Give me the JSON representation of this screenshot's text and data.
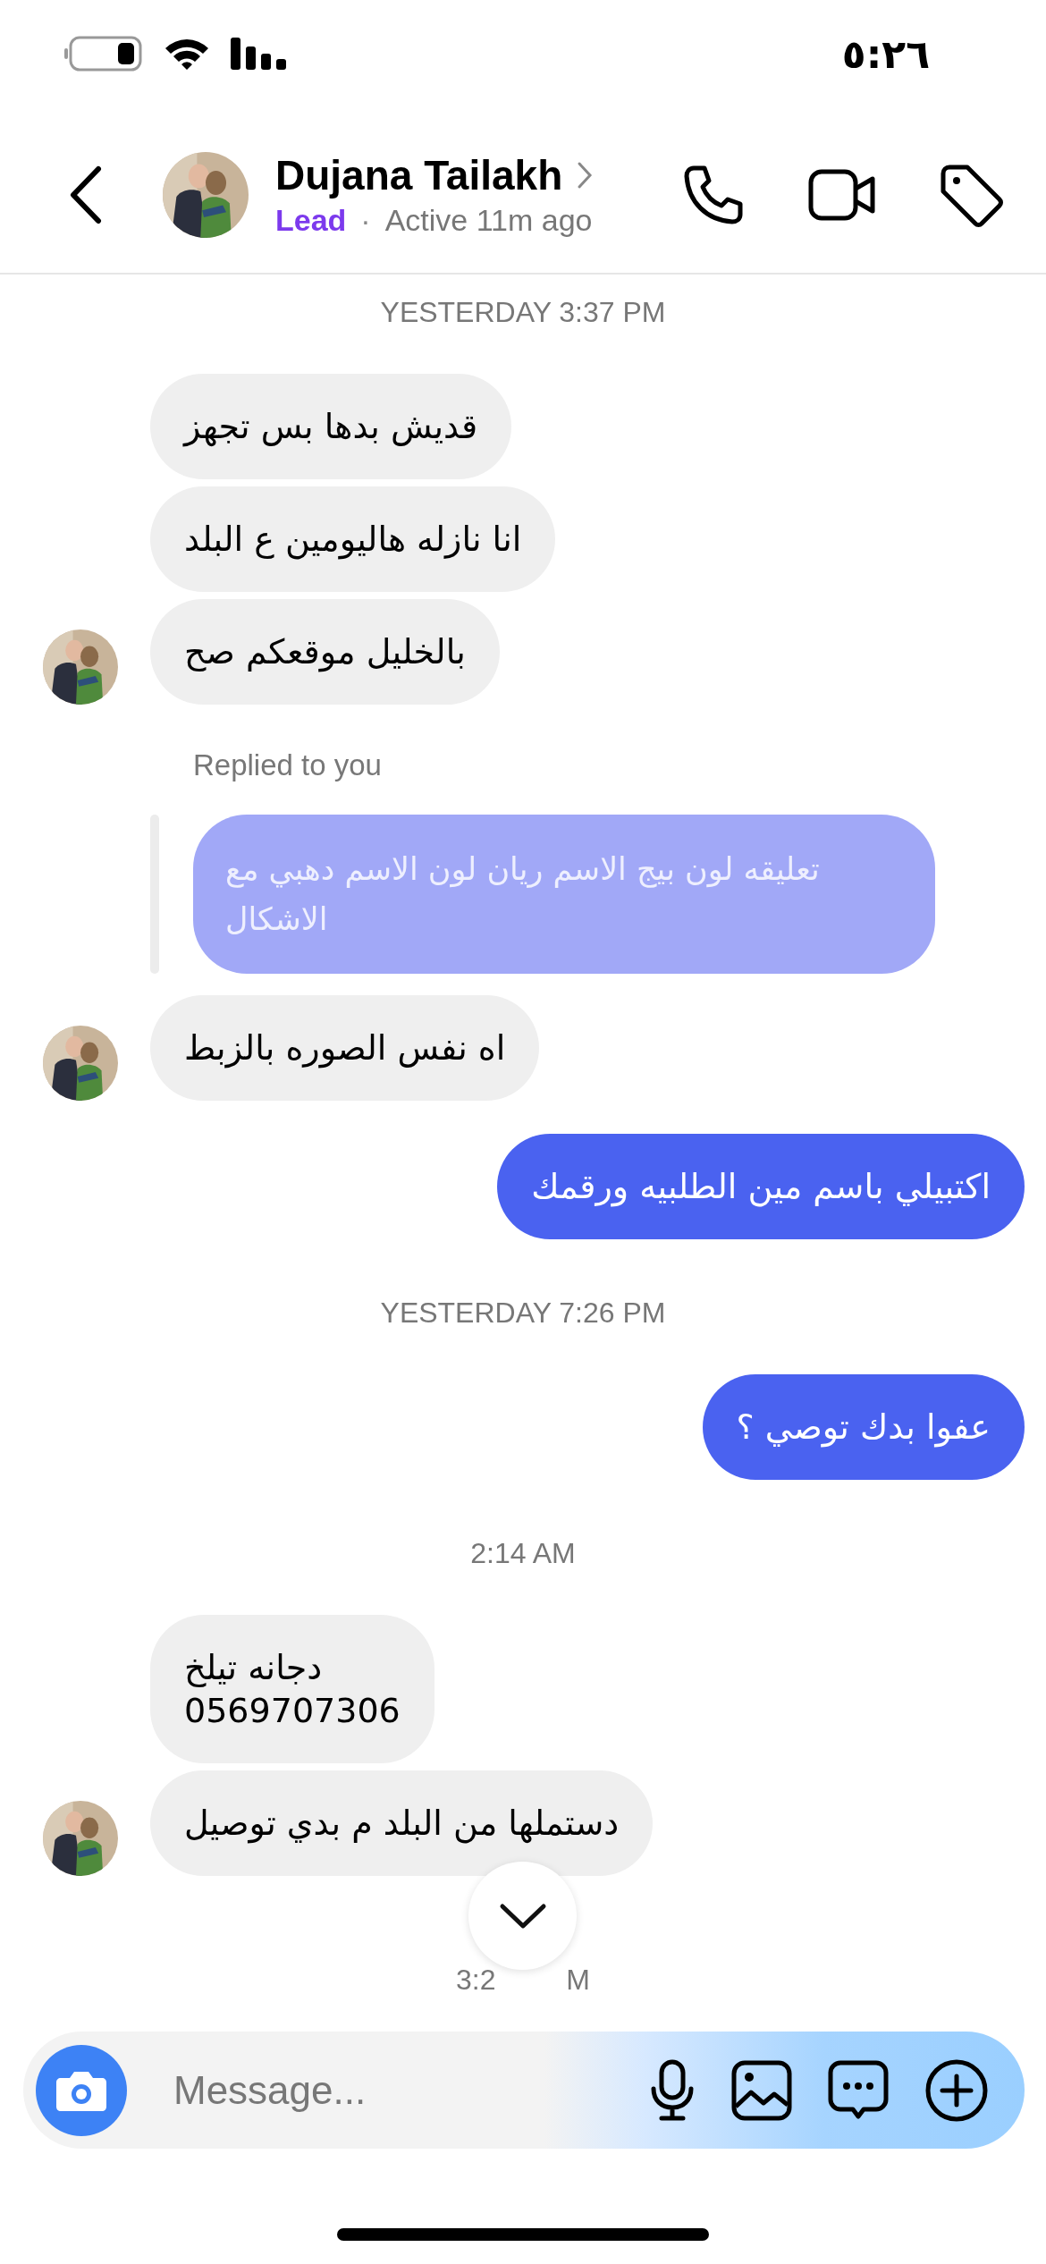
{
  "status_bar": {
    "time": "٥:٢٦"
  },
  "header": {
    "name": "Dujana Tailakh",
    "label": "Lead",
    "separator": "·",
    "activity": "Active 11m ago"
  },
  "messages": [
    {
      "kind": "time",
      "text": "YESTERDAY 3:37 PM"
    },
    {
      "kind": "incoming",
      "text": "قديش بدها بس تجهز",
      "avatar": false
    },
    {
      "kind": "incoming",
      "text": "انا نازله هاليومين ع البلد",
      "avatar": false
    },
    {
      "kind": "incoming",
      "text": "بالخليل موقعكم صح",
      "avatar": true
    },
    {
      "kind": "reply_label",
      "text": "Replied to you"
    },
    {
      "kind": "reply",
      "text": "تعليقه لون بيج الاسم ريان لون  الاسم دهبي مع الاشكال"
    },
    {
      "kind": "incoming",
      "text": "اه نفس الصوره بالزبط",
      "avatar": true
    },
    {
      "kind": "outgoing",
      "text": "اكتبيلي باسم مين الطلبيه ورقمك"
    },
    {
      "kind": "time",
      "text": "YESTERDAY 7:26 PM"
    },
    {
      "kind": "outgoing",
      "text": "عفوا بدك توصي ؟"
    },
    {
      "kind": "time",
      "text": "2:14 AM"
    },
    {
      "kind": "incoming",
      "text": "دجانه تيلخ\n0569707306",
      "avatar": false
    },
    {
      "kind": "incoming",
      "text": "دستملها من البلد م بدي توصيل",
      "avatar": true
    },
    {
      "kind": "time_partial",
      "text": "3:2 M"
    }
  ],
  "composer": {
    "placeholder": "Message..."
  }
}
